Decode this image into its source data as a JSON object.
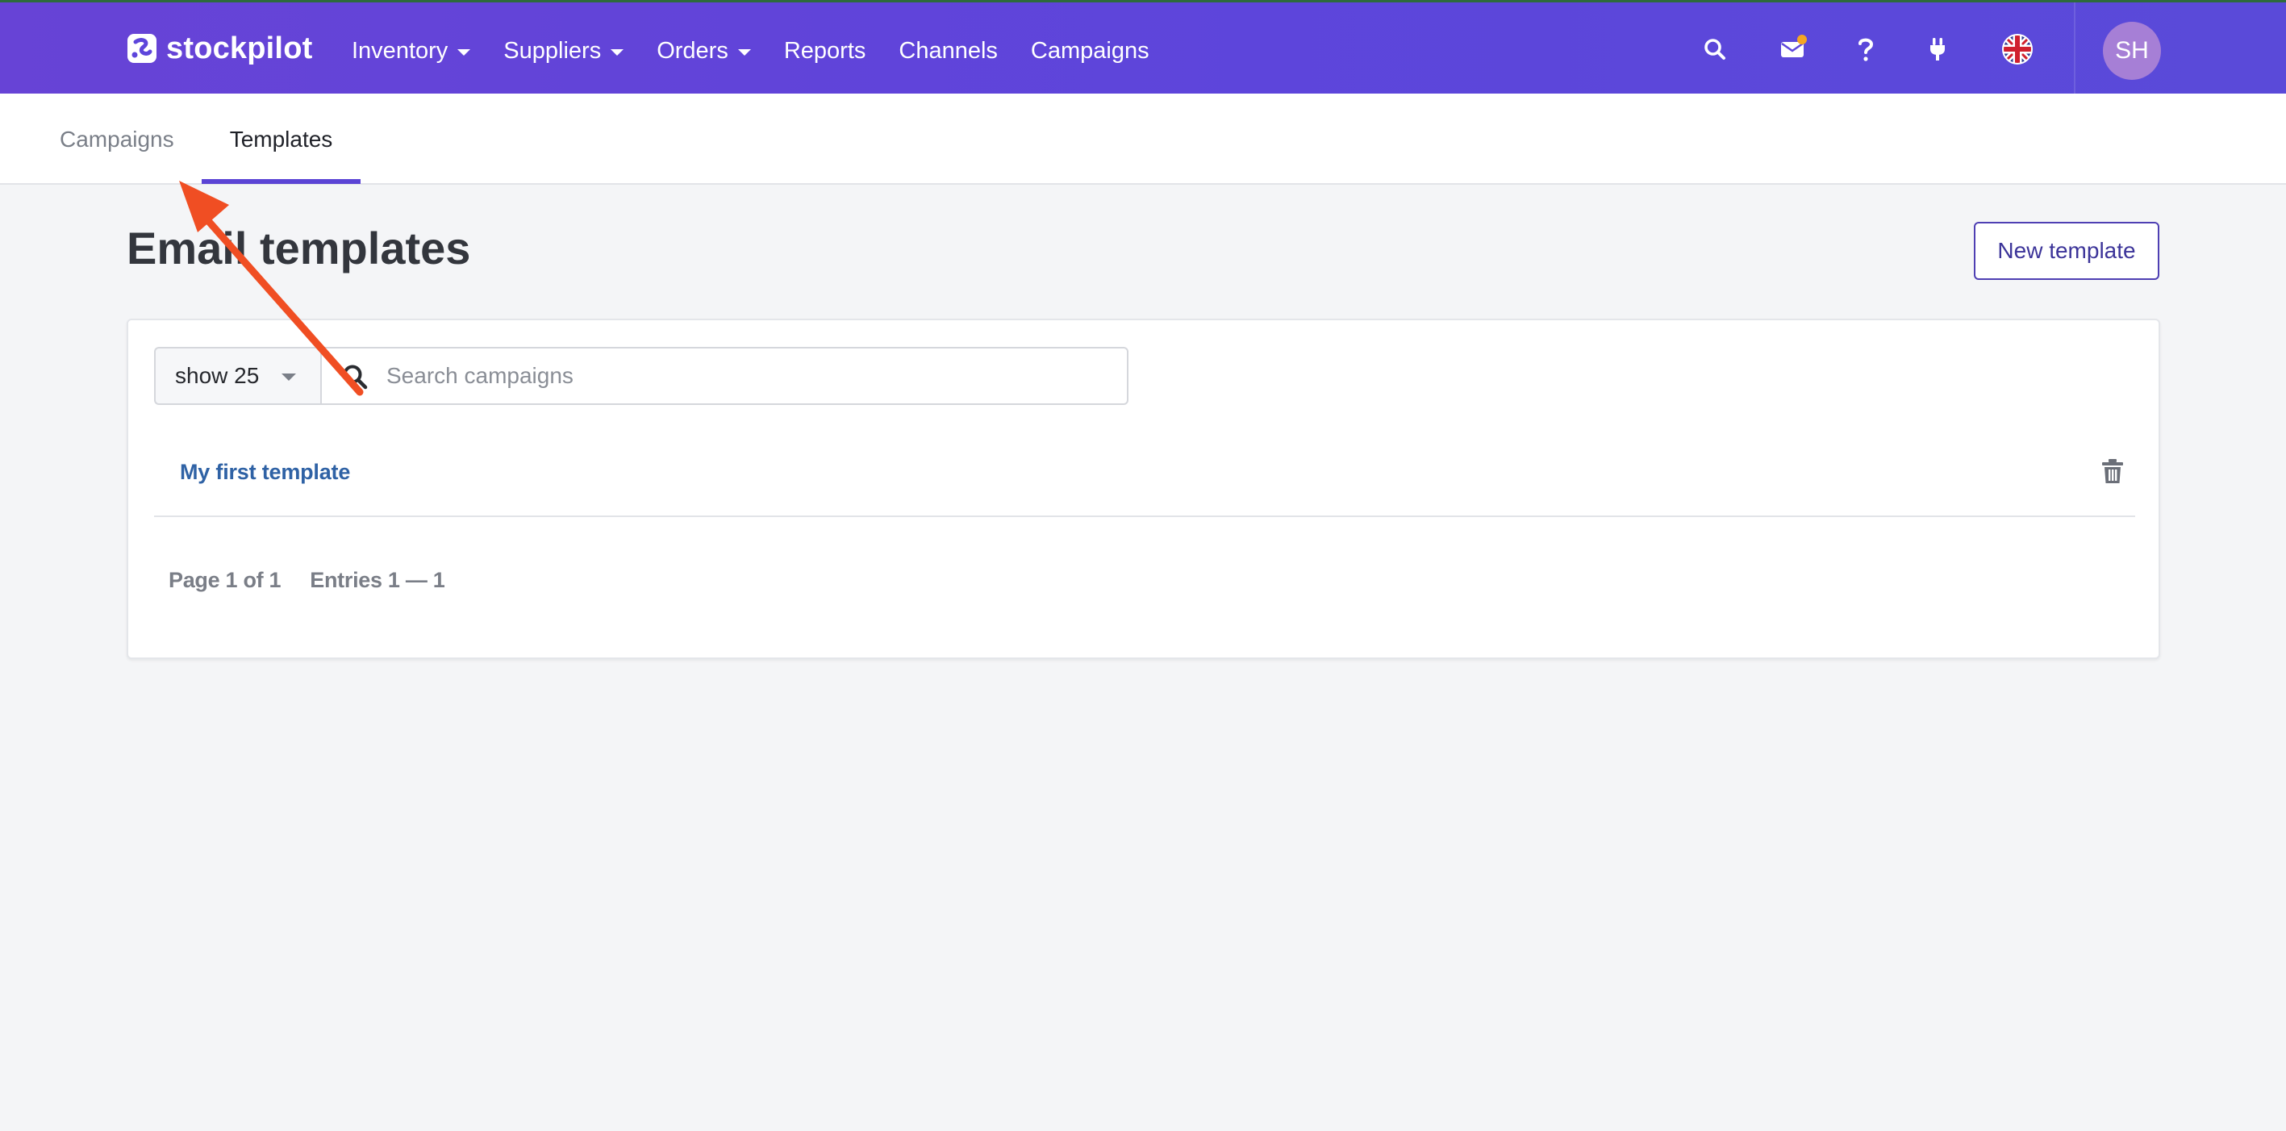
{
  "app": {
    "brand": "stockpilot",
    "nav": [
      {
        "label": "Inventory",
        "has_dropdown": true
      },
      {
        "label": "Suppliers",
        "has_dropdown": true
      },
      {
        "label": "Orders",
        "has_dropdown": true
      },
      {
        "label": "Reports",
        "has_dropdown": false
      },
      {
        "label": "Channels",
        "has_dropdown": false
      },
      {
        "label": "Campaigns",
        "has_dropdown": false
      }
    ],
    "icons": [
      "search-icon",
      "mail-icon",
      "help-icon",
      "plug-icon",
      "uk-flag-icon"
    ],
    "avatar_initials": "SH",
    "colors": {
      "nav_bg": "#5d45db",
      "accent": "#5b44d5",
      "notification": "#f5a623",
      "link": "#2f62a5"
    }
  },
  "subnav": {
    "tabs": [
      {
        "label": "Campaigns",
        "active": false
      },
      {
        "label": "Templates",
        "active": true
      }
    ]
  },
  "page": {
    "title": "Email templates",
    "new_button": "New template"
  },
  "list": {
    "page_size": "show 25",
    "search_placeholder": "Search campaigns",
    "rows": [
      {
        "name": "My first template"
      }
    ],
    "pagination": {
      "page": "Page 1 of 1",
      "entries": "Entries 1 — 1"
    }
  },
  "annotation": {
    "type": "arrow",
    "color": "#f04e23",
    "points_to": "tab-campaigns"
  }
}
